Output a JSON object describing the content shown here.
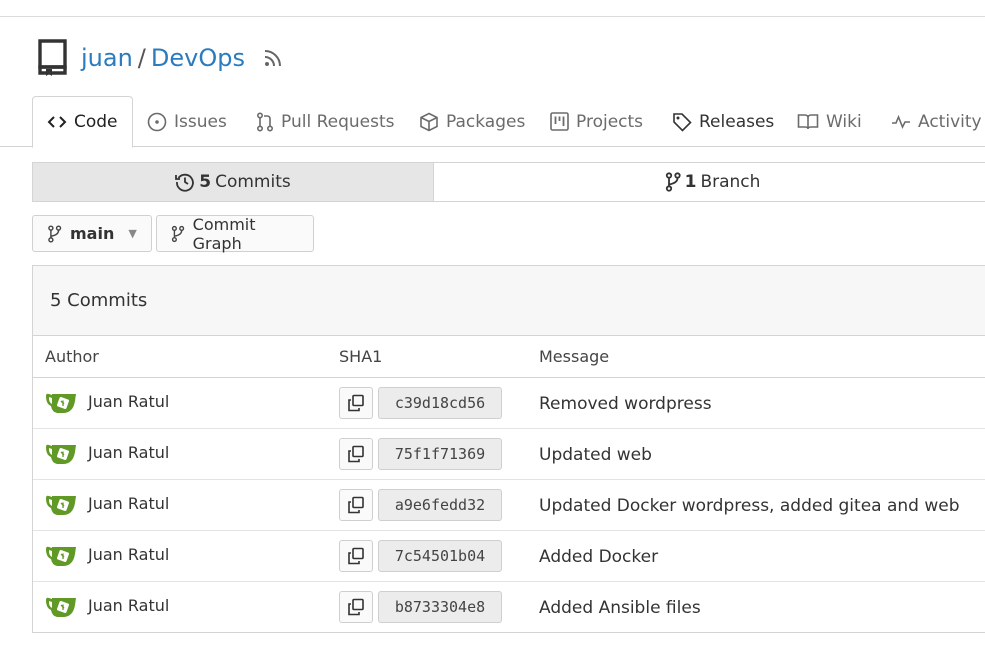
{
  "repo": {
    "owner": "juan",
    "separator": "/",
    "name": "DevOps"
  },
  "tabs": [
    {
      "label": "Code",
      "icon": "code-icon",
      "active": true
    },
    {
      "label": "Issues",
      "icon": "issue-icon"
    },
    {
      "label": "Pull Requests",
      "icon": "pull-request-icon"
    },
    {
      "label": "Packages",
      "icon": "package-icon"
    },
    {
      "label": "Projects",
      "icon": "project-icon"
    },
    {
      "label": "Releases",
      "icon": "tag-icon"
    },
    {
      "label": "Wiki",
      "icon": "book-icon"
    },
    {
      "label": "Activity",
      "icon": "pulse-icon"
    }
  ],
  "stats": {
    "commits_count": "5",
    "commits_label": "Commits",
    "branches_count": "1",
    "branches_label": "Branch"
  },
  "branch_selector": {
    "label": "main"
  },
  "commit_graph": {
    "label": "Commit Graph"
  },
  "commits_box": {
    "title": "5 Commits",
    "columns": {
      "author": "Author",
      "sha": "SHA1",
      "message": "Message"
    },
    "rows": [
      {
        "author": "Juan Ratul",
        "sha": "c39d18cd56",
        "message": "Removed wordpress"
      },
      {
        "author": "Juan Ratul",
        "sha": "75f1f71369",
        "message": "Updated web"
      },
      {
        "author": "Juan Ratul",
        "sha": "a9e6fedd32",
        "message": "Updated Docker wordpress, added gitea and web"
      },
      {
        "author": "Juan Ratul",
        "sha": "7c54501b04",
        "message": "Added Docker"
      },
      {
        "author": "Juan Ratul",
        "sha": "b8733304e8",
        "message": "Added Ansible files"
      }
    ]
  },
  "colors": {
    "link": "#2b7bbf",
    "gitea_green": "#609926"
  }
}
